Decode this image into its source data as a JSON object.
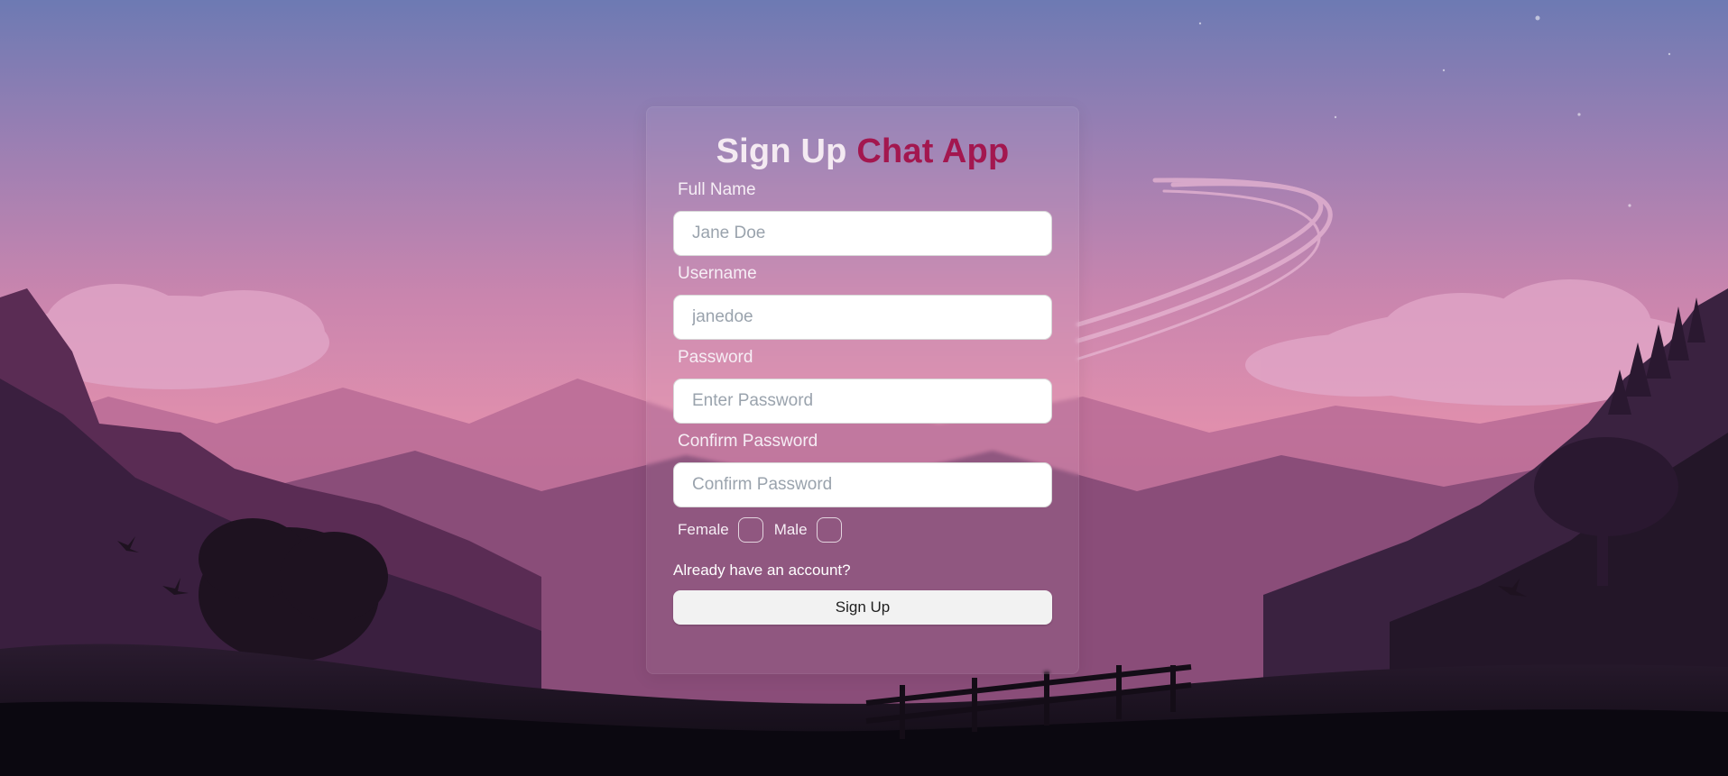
{
  "title": {
    "prefix": "Sign Up",
    "accent": "Chat App"
  },
  "colors": {
    "accent": "#a3174f",
    "sky_top": "#6d7ab3",
    "sky_mid": "#d889ad"
  },
  "form": {
    "full_name": {
      "label": "Full Name",
      "placeholder": "Jane Doe",
      "value": ""
    },
    "username": {
      "label": "Username",
      "placeholder": "janedoe",
      "value": ""
    },
    "password": {
      "label": "Password",
      "placeholder": "Enter Password",
      "value": ""
    },
    "confirm_password": {
      "label": "Confirm Password",
      "placeholder": "Confirm Password",
      "value": ""
    },
    "gender": {
      "female_label": "Female",
      "male_label": "Male",
      "female_checked": false,
      "male_checked": false
    },
    "login_link": "Already have an account?",
    "submit_label": "Sign Up"
  }
}
